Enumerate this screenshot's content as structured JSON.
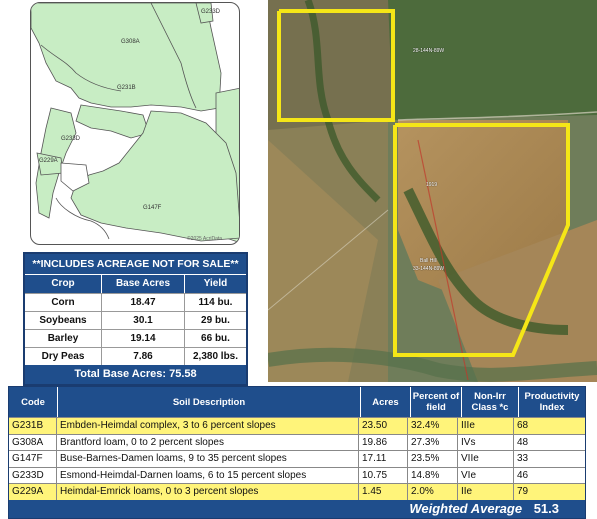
{
  "soil_map": {
    "labels": [
      "G233D",
      "G308A",
      "G231B",
      "G233D",
      "G229A",
      "G147F"
    ],
    "copyright": "©2025 AcriData"
  },
  "aerial": {
    "labels": [
      "28-144N-89W",
      "Ball Hill",
      "33-144N-89W",
      "1919"
    ]
  },
  "crop_table": {
    "banner": "**INCLUDES ACREAGE NOT FOR SALE**",
    "headers": [
      "Crop",
      "Base Acres",
      "Yield"
    ],
    "rows": [
      {
        "crop": "Corn",
        "base_acres": "18.47",
        "yield": "114 bu."
      },
      {
        "crop": "Soybeans",
        "base_acres": "30.1",
        "yield": "29 bu."
      },
      {
        "crop": "Barley",
        "base_acres": "19.14",
        "yield": "66 bu."
      },
      {
        "crop": "Dry Peas",
        "base_acres": "7.86",
        "yield": "2,380 lbs."
      }
    ],
    "total_label": "Total Base Acres:",
    "total_value": "75.58"
  },
  "soil_table": {
    "headers": {
      "code": "Code",
      "description": "Soil Description",
      "acres": "Acres",
      "percent": "Percent of field",
      "class": "Non-Irr Class *c",
      "productivity": "Productivity Index"
    },
    "rows": [
      {
        "code": "G231B",
        "description": "Embden-Heimdal complex, 3 to 6 percent slopes",
        "acres": "23.50",
        "percent": "32.4%",
        "class": "IIIe",
        "productivity": "68",
        "highlight": true
      },
      {
        "code": "G308A",
        "description": "Brantford loam, 0 to 2 percent slopes",
        "acres": "19.86",
        "percent": "27.3%",
        "class": "IVs",
        "productivity": "48",
        "highlight": false
      },
      {
        "code": "G147F",
        "description": "Buse-Barnes-Damen loams, 9 to 35 percent slopes",
        "acres": "17.11",
        "percent": "23.5%",
        "class": "VIIe",
        "productivity": "33",
        "highlight": false
      },
      {
        "code": "G233D",
        "description": "Esmond-Heimdal-Darnen loams, 6 to 15 percent slopes",
        "acres": "10.75",
        "percent": "14.8%",
        "class": "VIe",
        "productivity": "46",
        "highlight": false
      },
      {
        "code": "G229A",
        "description": "Heimdal-Emrick loams, 0 to 3 percent slopes",
        "acres": "1.45",
        "percent": "2.0%",
        "class": "IIe",
        "productivity": "79",
        "highlight": true
      }
    ],
    "weighted_average_label": "Weighted Average",
    "weighted_average_value": "51.3"
  },
  "colors": {
    "header_blue": "#1f4e8c",
    "highlight_yellow": "#fff47a",
    "soil_green": "#c8edc4",
    "boundary_yellow": "#f5e617"
  }
}
